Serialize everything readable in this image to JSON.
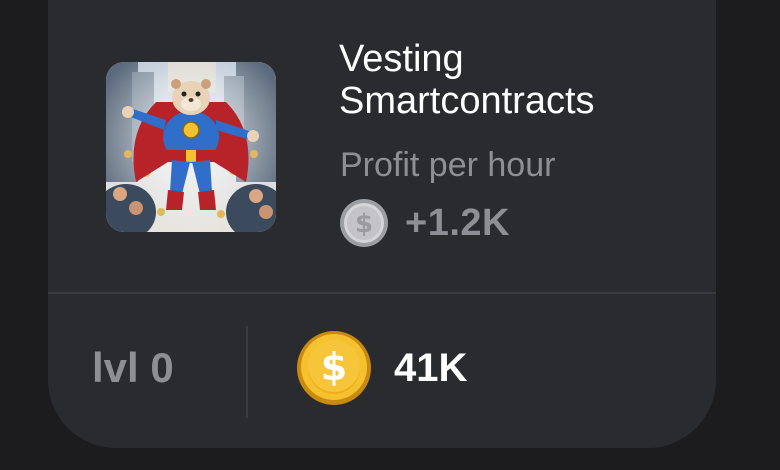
{
  "card": {
    "title": "Vesting Smartcontracts",
    "profit_label": "Profit per hour",
    "profit_value": "+1.2K",
    "profit_icon": "silver-coin-icon",
    "level_label": "lvl 0",
    "price_value": "41K",
    "price_icon": "gold-coin-icon",
    "image_icon": "superhero-hamster-image"
  },
  "colors": {
    "background": "#1c1c1e",
    "card": "#2a2b2f",
    "muted_text": "#8e8f94",
    "primary_text": "#ffffff",
    "gold": "#f5c12e",
    "silver": "#c9c9cc"
  }
}
